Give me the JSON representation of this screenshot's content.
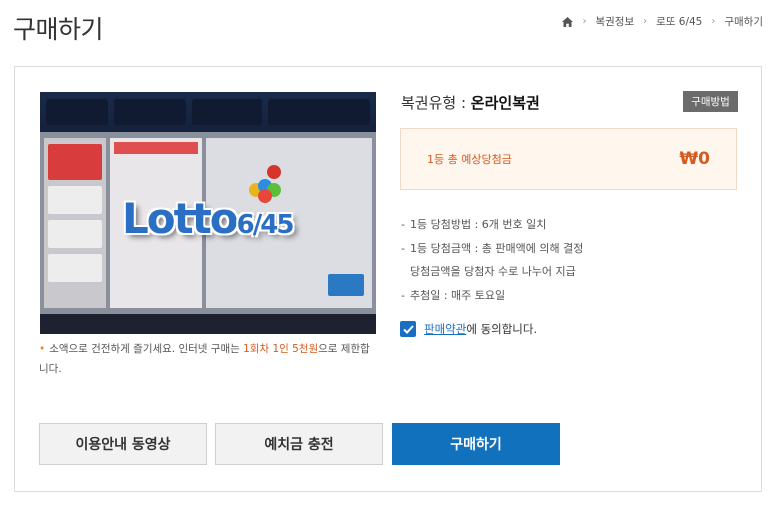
{
  "page": {
    "title": "구매하기"
  },
  "breadcrumb": {
    "items": [
      "복권정보",
      "로또 6/45",
      "구매하기"
    ]
  },
  "ticket": {
    "logo_text": "Lotto",
    "logo_sub": "6/45"
  },
  "notice": {
    "text_before": "소액으로 건전하게 즐기세요. 인터넷 구매는 ",
    "highlight": "1회차 1인 5천원",
    "text_after": "으로 제한합니다."
  },
  "ticket_type": {
    "label": "복권유형 : ",
    "value": "온라인복권"
  },
  "howto_button": "구매방법",
  "prize": {
    "label": "1등 총 예상당첨금",
    "value": "₩0"
  },
  "info": {
    "items": [
      "1등 당첨방법 : 6개 번호 일치",
      "1등 당첨금액 : 총 판매액에 의해 결정",
      "당첨금액을 당첨자 수로 나누어 지급",
      "추첨일 : 매주 토요일"
    ]
  },
  "agree": {
    "link": "판매약관",
    "text": "에 동의합니다.",
    "checked": true
  },
  "buttons": {
    "guide_video": "이용안내 동영상",
    "deposit": "예치금 충전",
    "purchase": "구매하기"
  },
  "colors": {
    "accent_blue": "#1171bd",
    "prize_orange": "#d55a1f",
    "bullet_orange": "#e58a2b"
  }
}
